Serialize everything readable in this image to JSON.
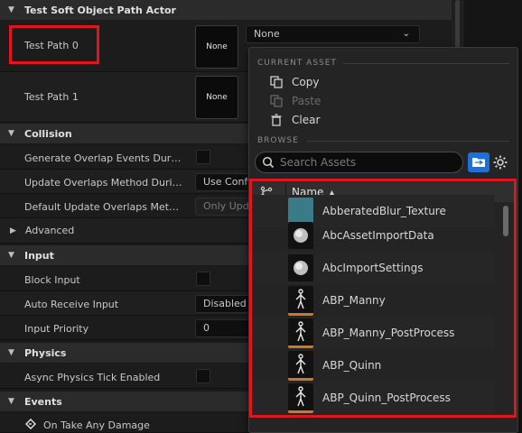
{
  "details": {
    "sections": {
      "actor": "Test Soft Object Path Actor",
      "collision": "Collision",
      "advanced": "Advanced",
      "input": "Input",
      "physics": "Physics",
      "events": "Events"
    },
    "test_path_0": {
      "label": "Test Path 0",
      "thumb_text": "None",
      "combo_value": "None"
    },
    "test_path_1": {
      "label": "Test Path 1",
      "thumb_text": "None"
    },
    "collision_rows": [
      {
        "label": "Generate Overlap Events During..."
      },
      {
        "label": "Update Overlaps Method During...",
        "value": "Use Confi"
      },
      {
        "label": "Default Update Overlaps Method...",
        "value": "Only Upda"
      }
    ],
    "input_rows": [
      {
        "label": "Block Input"
      },
      {
        "label": "Auto Receive Input",
        "value": "Disabled"
      },
      {
        "label": "Input Priority",
        "value": "0"
      }
    ],
    "physics_rows": [
      {
        "label": "Async Physics Tick Enabled"
      }
    ],
    "events_rows": [
      {
        "label": "On Take Any Damage"
      }
    ]
  },
  "popup": {
    "current_asset_heading": "CURRENT ASSET",
    "copy": "Copy",
    "paste": "Paste",
    "clear": "Clear",
    "browse_heading": "BROWSE",
    "search_placeholder": "Search Assets",
    "column_name": "Name",
    "assets": [
      {
        "name": "AbberatedBlur_Texture",
        "icon": "texture-icon"
      },
      {
        "name": "AbcAssetImportData",
        "icon": "sphere-icon"
      },
      {
        "name": "AbcImportSettings",
        "icon": "sphere-icon"
      },
      {
        "name": "ABP_Manny",
        "icon": "skeleton-icon"
      },
      {
        "name": "ABP_Manny_PostProcess",
        "icon": "skeleton-icon"
      },
      {
        "name": "ABP_Quinn",
        "icon": "skeleton-icon"
      },
      {
        "name": "ABP_Quinn_PostProcess",
        "icon": "skeleton-icon"
      }
    ]
  },
  "colors": {
    "highlight": "#e0161d",
    "accent_blue": "#1e6fd6",
    "anim_blueprint": "#c87a2a"
  }
}
